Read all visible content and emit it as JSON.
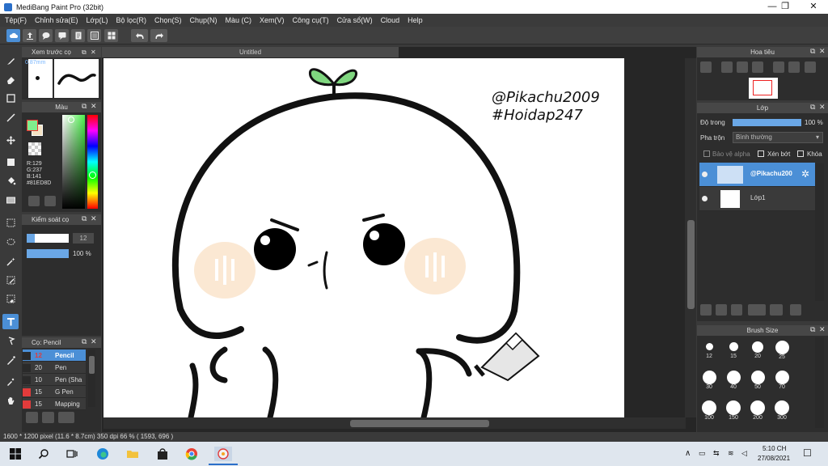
{
  "window": {
    "title": "MediBang Paint Pro (32bit)",
    "minimize": "—",
    "maximize": "❐",
    "close": "✕"
  },
  "menu": [
    "Tệp(F)",
    "Chỉnh sửa(E)",
    "Lớp(L)",
    "Bộ lọc(R)",
    "Chọn(S)",
    "Chụp(N)",
    "Màu (C)",
    "Xem(V)",
    "Công cụ(T)",
    "Cửa sổ(W)",
    "Cloud",
    "Help"
  ],
  "document": {
    "tab_title": "Untitled",
    "watermark_line1": "@Pikachu2009",
    "watermark_line2": "#Hoidap247"
  },
  "brush_preview": {
    "title": "Xem trước cọ",
    "size_text": "0.87mm"
  },
  "color_panel": {
    "title": "Màu",
    "r": "R:129",
    "g": "G:237",
    "b": "B:141",
    "hex": "#81ED8D",
    "primary": "#81ED8D",
    "secondary": "#f3e3c4"
  },
  "brush_control": {
    "title": "Kiểm soát cọ",
    "size_value": "12",
    "opacity_value": "100 %"
  },
  "brush_list": {
    "title": "Cọ: Pencil",
    "items": [
      {
        "size": "12",
        "name": "Pencil",
        "color": "#2a2a2a"
      },
      {
        "size": "20",
        "name": "Pen",
        "color": "#2a2a2a"
      },
      {
        "size": "10",
        "name": "Pen (Sha",
        "color": "#2a2a2a"
      },
      {
        "size": "15",
        "name": "G Pen",
        "color": "#e23b3b"
      },
      {
        "size": "15",
        "name": "Mapping",
        "color": "#e23b3b"
      }
    ]
  },
  "navigator": {
    "title": "Hoa tiêu"
  },
  "layers": {
    "title": "Lớp",
    "opacity_label": "Độ trong",
    "opacity_value": "100 %",
    "blend_label": "Pha trộn",
    "blend_value": "Bình thường",
    "protect_alpha": "Bảo vệ alpha",
    "clipping": "Xén bớt",
    "lock": "Khóa",
    "items": [
      {
        "name": "@Pikachu200",
        "selected": true
      },
      {
        "name": "Lớp1",
        "selected": false
      }
    ]
  },
  "brush_size": {
    "title": "Brush Size",
    "sizes": [
      "12",
      "15",
      "20",
      "25",
      "30",
      "40",
      "50",
      "70",
      "100",
      "150",
      "200",
      "300"
    ]
  },
  "status": {
    "text": "1600 * 1200 pixel   (11.6 * 8.7cm)   350 dpi   66 %   ( 1593, 696 )"
  },
  "taskbar": {
    "time": "5:10 CH",
    "date": "27/08/2021"
  }
}
